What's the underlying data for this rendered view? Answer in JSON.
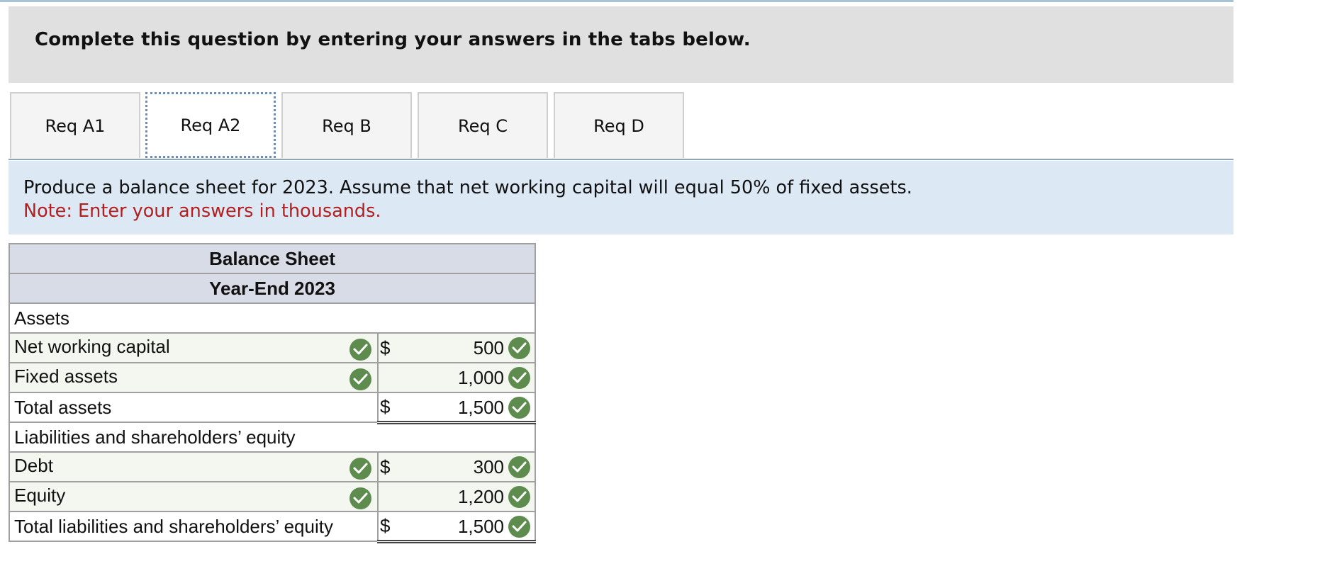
{
  "header": {
    "title": "Complete this question by entering your answers in the tabs below."
  },
  "tabs": [
    {
      "label": "Req A1",
      "active": false
    },
    {
      "label": "Req A2",
      "active": true
    },
    {
      "label": "Req B",
      "active": false
    },
    {
      "label": "Req C",
      "active": false
    },
    {
      "label": "Req D",
      "active": false
    }
  ],
  "instructions": {
    "text": "Produce a balance sheet for 2023. Assume that net working capital will equal 50% of fixed assets.",
    "note": "Note: Enter your answers in thousands."
  },
  "balance_sheet": {
    "title": "Balance Sheet",
    "subtitle": "Year-End 2023",
    "assets_label": "Assets",
    "rows": {
      "nwc": {
        "label": "Net working capital",
        "currency": "$",
        "value": "500"
      },
      "fixed": {
        "label": "Fixed assets",
        "currency": "",
        "value": "1,000"
      },
      "total_assets": {
        "label": "Total assets",
        "currency": "$",
        "value": "1,500"
      },
      "liab_label": "Liabilities and shareholders’ equity",
      "debt": {
        "label": "Debt",
        "currency": "$",
        "value": "300"
      },
      "equity": {
        "label": "Equity",
        "currency": "",
        "value": "1,200"
      },
      "total_liab": {
        "label": "Total liabilities and shareholders’ equity",
        "currency": "$",
        "value": "1,500"
      }
    }
  },
  "colors": {
    "check": "#5e8c4e",
    "note": "#b21f1f",
    "instructions_bg": "#dce9f5"
  }
}
